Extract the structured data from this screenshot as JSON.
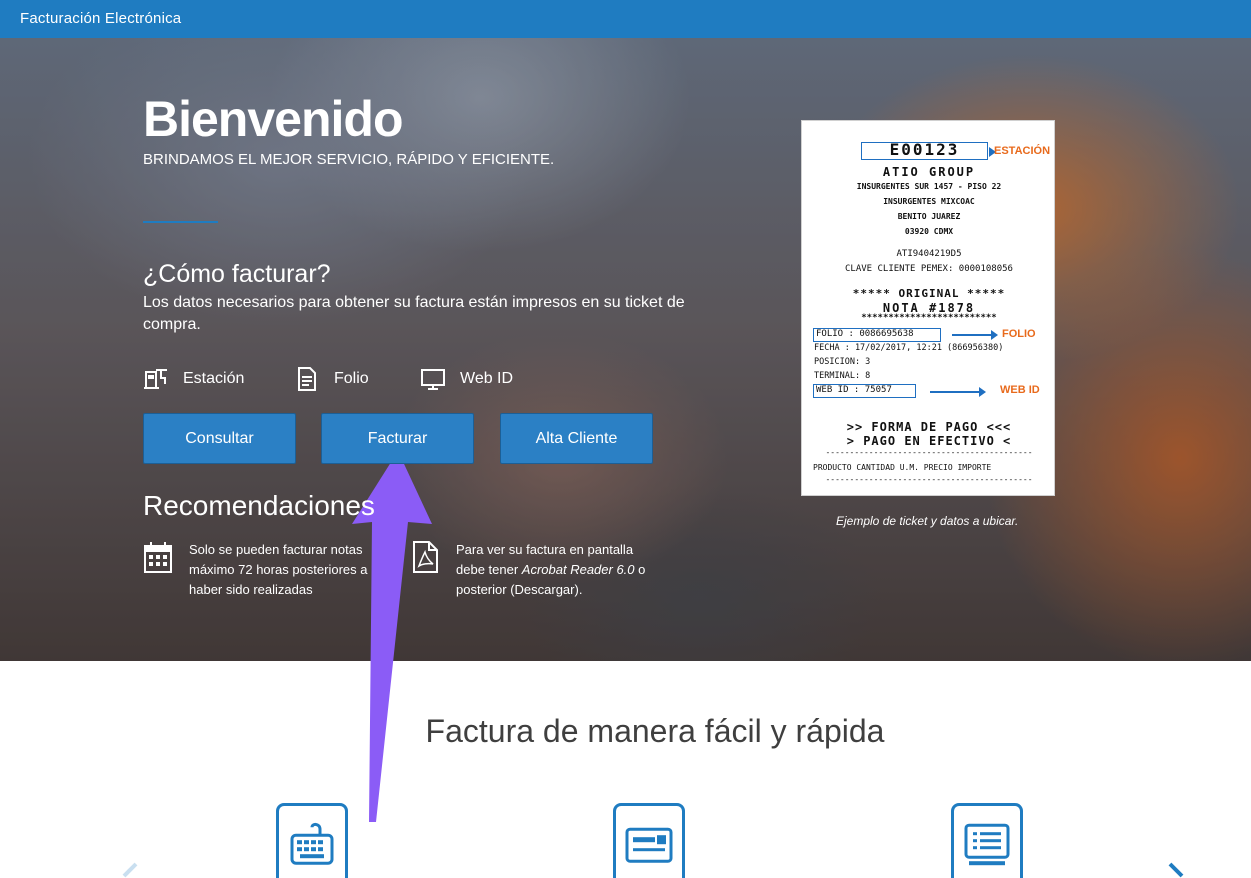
{
  "header": {
    "brand": "Facturación Electrónica"
  },
  "hero": {
    "title": "Bienvenido",
    "subtitle": "BRINDAMOS EL MEJOR SERVICIO, RÁPIDO Y EFICIENTE.",
    "how_title": "¿Cómo facturar?",
    "how_desc": "Los datos necesarios para obtener su factura están impresos en su ticket de compra.",
    "info_items": [
      {
        "icon": "gas-station-icon",
        "label": "Estación"
      },
      {
        "icon": "document-icon",
        "label": "Folio"
      },
      {
        "icon": "monitor-icon",
        "label": "Web ID"
      }
    ],
    "buttons": {
      "consultar": "Consultar",
      "facturar": "Facturar",
      "alta": "Alta Cliente"
    },
    "recommendations_title": "Recomendaciones",
    "recommendations": [
      {
        "icon": "calendar-icon",
        "text": "Solo se pueden facturar notas máximo 72 horas posteriores a haber sido realizadas"
      },
      {
        "icon": "pdf-icon",
        "text_before": "Para ver su factura en pantalla debe tener ",
        "text_em": "Acrobat Reader 6.0",
        "text_after": " o posterior (Descargar)."
      }
    ]
  },
  "ticket": {
    "station_code": "E00123",
    "station_tag": "ESTACIÓN",
    "company": "ATIO GROUP",
    "addr1": "INSURGENTES SUR 1457 - PISO 22",
    "addr2": "INSURGENTES MIXCOAC",
    "addr3": "BENITO JUAREZ",
    "addr4": "03920 CDMX",
    "rfc": "ATI9404219D5",
    "client": "CLAVE CLIENTE PEMEX: 0000108056",
    "original": "***** ORIGINAL *****",
    "nota": "NOTA #1878",
    "stars": "*************************",
    "folio": "FOLIO   : 0086695638",
    "folio_tag": "FOLIO",
    "fecha": "FECHA   : 17/02/2017, 12:21 (866956380)",
    "posicion": "POSICION: 3",
    "terminal": "TERMINAL: 8",
    "webid": "WEB ID  : 75057",
    "webid_tag": "WEB ID",
    "pago1": ">> FORMA DE PAGO <<<",
    "pago2": "> PAGO EN EFECTIVO <",
    "dashes": "-------------------------------------------",
    "cols": "PRODUCTO CANTIDAD U.M. PRECIO    IMPORTE",
    "caption": "Ejemplo de ticket y datos a ubicar."
  },
  "section": {
    "title": "Factura de manera fácil y rápida"
  },
  "features": [
    {
      "icon": "keyboard-icon"
    },
    {
      "icon": "card-icon"
    },
    {
      "icon": "list-screen-icon"
    }
  ],
  "colors": {
    "primary": "#1f7cc1",
    "button": "#2b80c5",
    "annotation": "#8b5cf6",
    "highlight": "#e86a1c"
  }
}
